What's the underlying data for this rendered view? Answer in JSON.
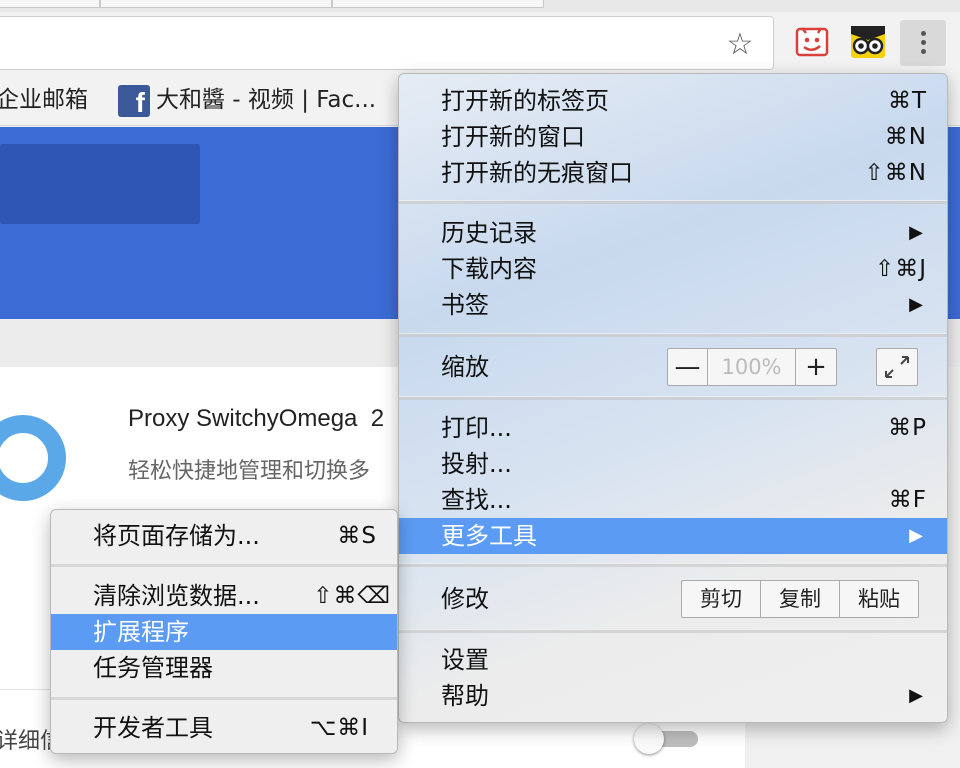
{
  "bookmarks": {
    "item1_label": "企业邮箱",
    "item2_label": "大和醬 - 视频 | Fac...",
    "facebook_icon_glyph": "f"
  },
  "toolbar": {
    "star_glyph": "☆",
    "menu_icon": "three-dots-vertical"
  },
  "extension_card": {
    "name": "Proxy SwitchyOmega",
    "name_trailing": "2",
    "description": "轻松快捷地管理和切换多",
    "details_link": "详细信"
  },
  "main_menu": {
    "items": [
      {
        "label": "打开新的标签页",
        "shortcut": "⌘T"
      },
      {
        "label": "打开新的窗口",
        "shortcut": "⌘N"
      },
      {
        "label": "打开新的无痕窗口",
        "shortcut": "⇧⌘N"
      },
      {
        "label": "历史记录",
        "arrow": "▶"
      },
      {
        "label": "下载内容",
        "shortcut": "⇧⌘J"
      },
      {
        "label": "书签",
        "arrow": "▶"
      },
      {
        "label": "缩放"
      },
      {
        "label": "打印...",
        "shortcut": "⌘P"
      },
      {
        "label": "投射..."
      },
      {
        "label": "查找...",
        "shortcut": "⌘F"
      },
      {
        "label": "更多工具",
        "arrow": "▶",
        "highlighted": true
      },
      {
        "label": "修改"
      },
      {
        "label": "设置"
      },
      {
        "label": "帮助",
        "arrow": "▶"
      }
    ],
    "zoom": {
      "minus": "—",
      "value": "100%",
      "plus": "+"
    },
    "edit": {
      "cut": "剪切",
      "copy": "复制",
      "paste": "粘贴"
    }
  },
  "sub_menu": {
    "items": [
      {
        "label": "将页面存储为...",
        "shortcut": "⌘S"
      },
      {
        "label": "清除浏览数据...",
        "shortcut": "⇧⌘⌫"
      },
      {
        "label": "扩展程序",
        "highlighted": true
      },
      {
        "label": "任务管理器"
      },
      {
        "label": "开发者工具",
        "shortcut": "⌥⌘I"
      }
    ]
  },
  "colors": {
    "highlight": "#5c9bf3",
    "banner": "#3d6bd6",
    "banner_box": "#2f56b4",
    "logo_ring": "#5aa8e8"
  }
}
